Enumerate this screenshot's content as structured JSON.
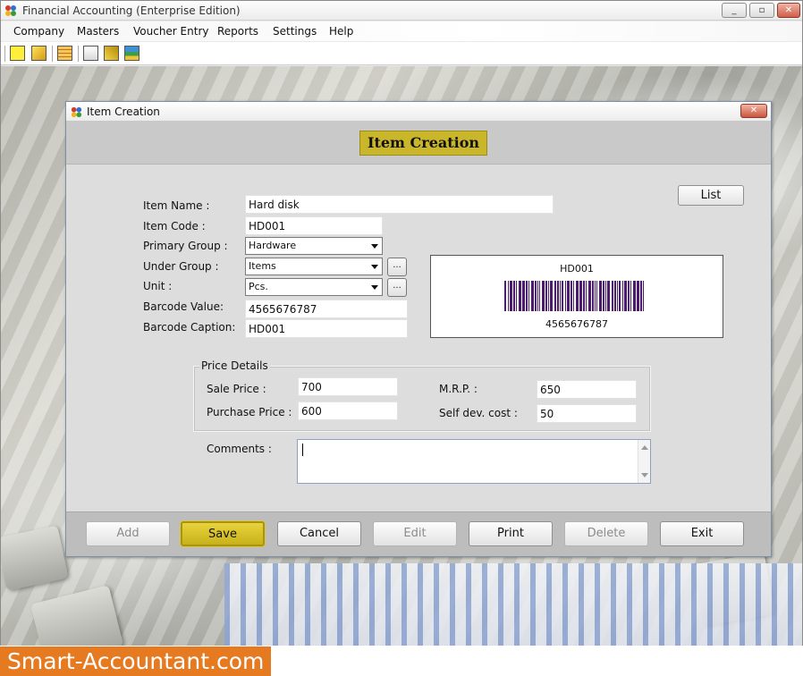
{
  "app": {
    "title": "Financial Accounting (Enterprise Edition)",
    "window_buttons": {
      "minimize": "_",
      "maximize": "▫",
      "close": "✕"
    }
  },
  "menu": {
    "items": [
      {
        "label": "Company"
      },
      {
        "label": "Masters"
      },
      {
        "label": "Voucher Entry"
      },
      {
        "label": "Reports"
      },
      {
        "label": "Settings"
      },
      {
        "label": "Help"
      }
    ]
  },
  "toolbar": {
    "icons": [
      "new-icon",
      "edit-icon",
      "table-icon",
      "stock-icon",
      "diamond-icon",
      "tree-icon"
    ]
  },
  "dialog": {
    "title": "Item Creation",
    "header": "Item Creation",
    "list_button": "List",
    "fields": {
      "item_name": {
        "label": "Item Name :",
        "value": "Hard disk"
      },
      "item_code": {
        "label": "Item Code :",
        "value": "HD001"
      },
      "primary_group": {
        "label": "Primary Group :",
        "value": "Hardware"
      },
      "under_group": {
        "label": "Under Group :",
        "value": "Items"
      },
      "unit": {
        "label": "Unit :",
        "value": "Pcs."
      },
      "barcode_value": {
        "label": "Barcode Value:",
        "value": "4565676787"
      },
      "barcode_caption": {
        "label": "Barcode Caption:",
        "value": "HD001"
      }
    },
    "browse_label": "...",
    "barcode_preview": {
      "caption": "HD001",
      "value": "4565676787"
    },
    "price_details": {
      "legend": "Price Details",
      "sale_price": {
        "label": "Sale Price :",
        "value": "700"
      },
      "purchase_price": {
        "label": "Purchase Price :",
        "value": "600"
      },
      "mrp": {
        "label": "M.R.P. :",
        "value": "650"
      },
      "self_dev_cost": {
        "label": "Self dev. cost :",
        "value": "50"
      }
    },
    "comments": {
      "label": "Comments :",
      "value": ""
    },
    "buttons": {
      "add": "Add",
      "save": "Save",
      "cancel": "Cancel",
      "edit": "Edit",
      "print": "Print",
      "delete": "Delete",
      "exit": "Exit"
    }
  },
  "footer": {
    "logo_text": "Smart-Accountant.com"
  },
  "colors": {
    "header_badge": "#c9b62a",
    "save_button": "#d4bf2a",
    "footer_logo": "#e57a21",
    "barcode_bars": "#4b1b6e"
  }
}
